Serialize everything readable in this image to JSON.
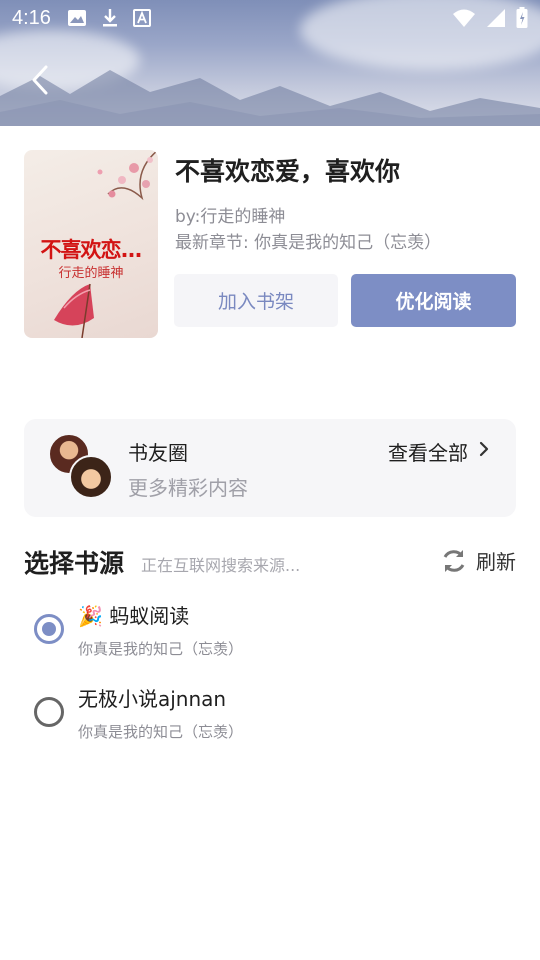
{
  "status_bar": {
    "time": "4:16",
    "left_icons": [
      "image-icon",
      "download-icon",
      "a-box-icon"
    ],
    "right_icons": [
      "wifi-icon",
      "signal-icon",
      "battery-icon"
    ]
  },
  "book": {
    "cover_title": "不喜欢恋...",
    "cover_author": "行走的睡神",
    "title": "不喜欢恋爱，喜欢你",
    "author": "by:行走的睡神",
    "latest_chapter": "最新章节: 你真是我的知己（忘羡）",
    "add_shelf_label": "加入书架",
    "optimize_label": "优化阅读"
  },
  "circle": {
    "title": "书友圈",
    "subtitle": "更多精彩内容",
    "view_all": "查看全部"
  },
  "sources": {
    "heading": "选择书源",
    "status": "正在互联网搜索来源...",
    "refresh_label": "刷新",
    "items": [
      {
        "name": "🎉 蚂蚁阅读",
        "chapter": "你真是我的知己（忘羡）",
        "selected": true
      },
      {
        "name": "无极小说ajnnan",
        "chapter": "你真是我的知己（忘羡）",
        "selected": false
      }
    ]
  },
  "colors": {
    "accent": "#7d8ec5",
    "muted_text": "#8d8d95",
    "card_bg": "#f6f6f8"
  }
}
